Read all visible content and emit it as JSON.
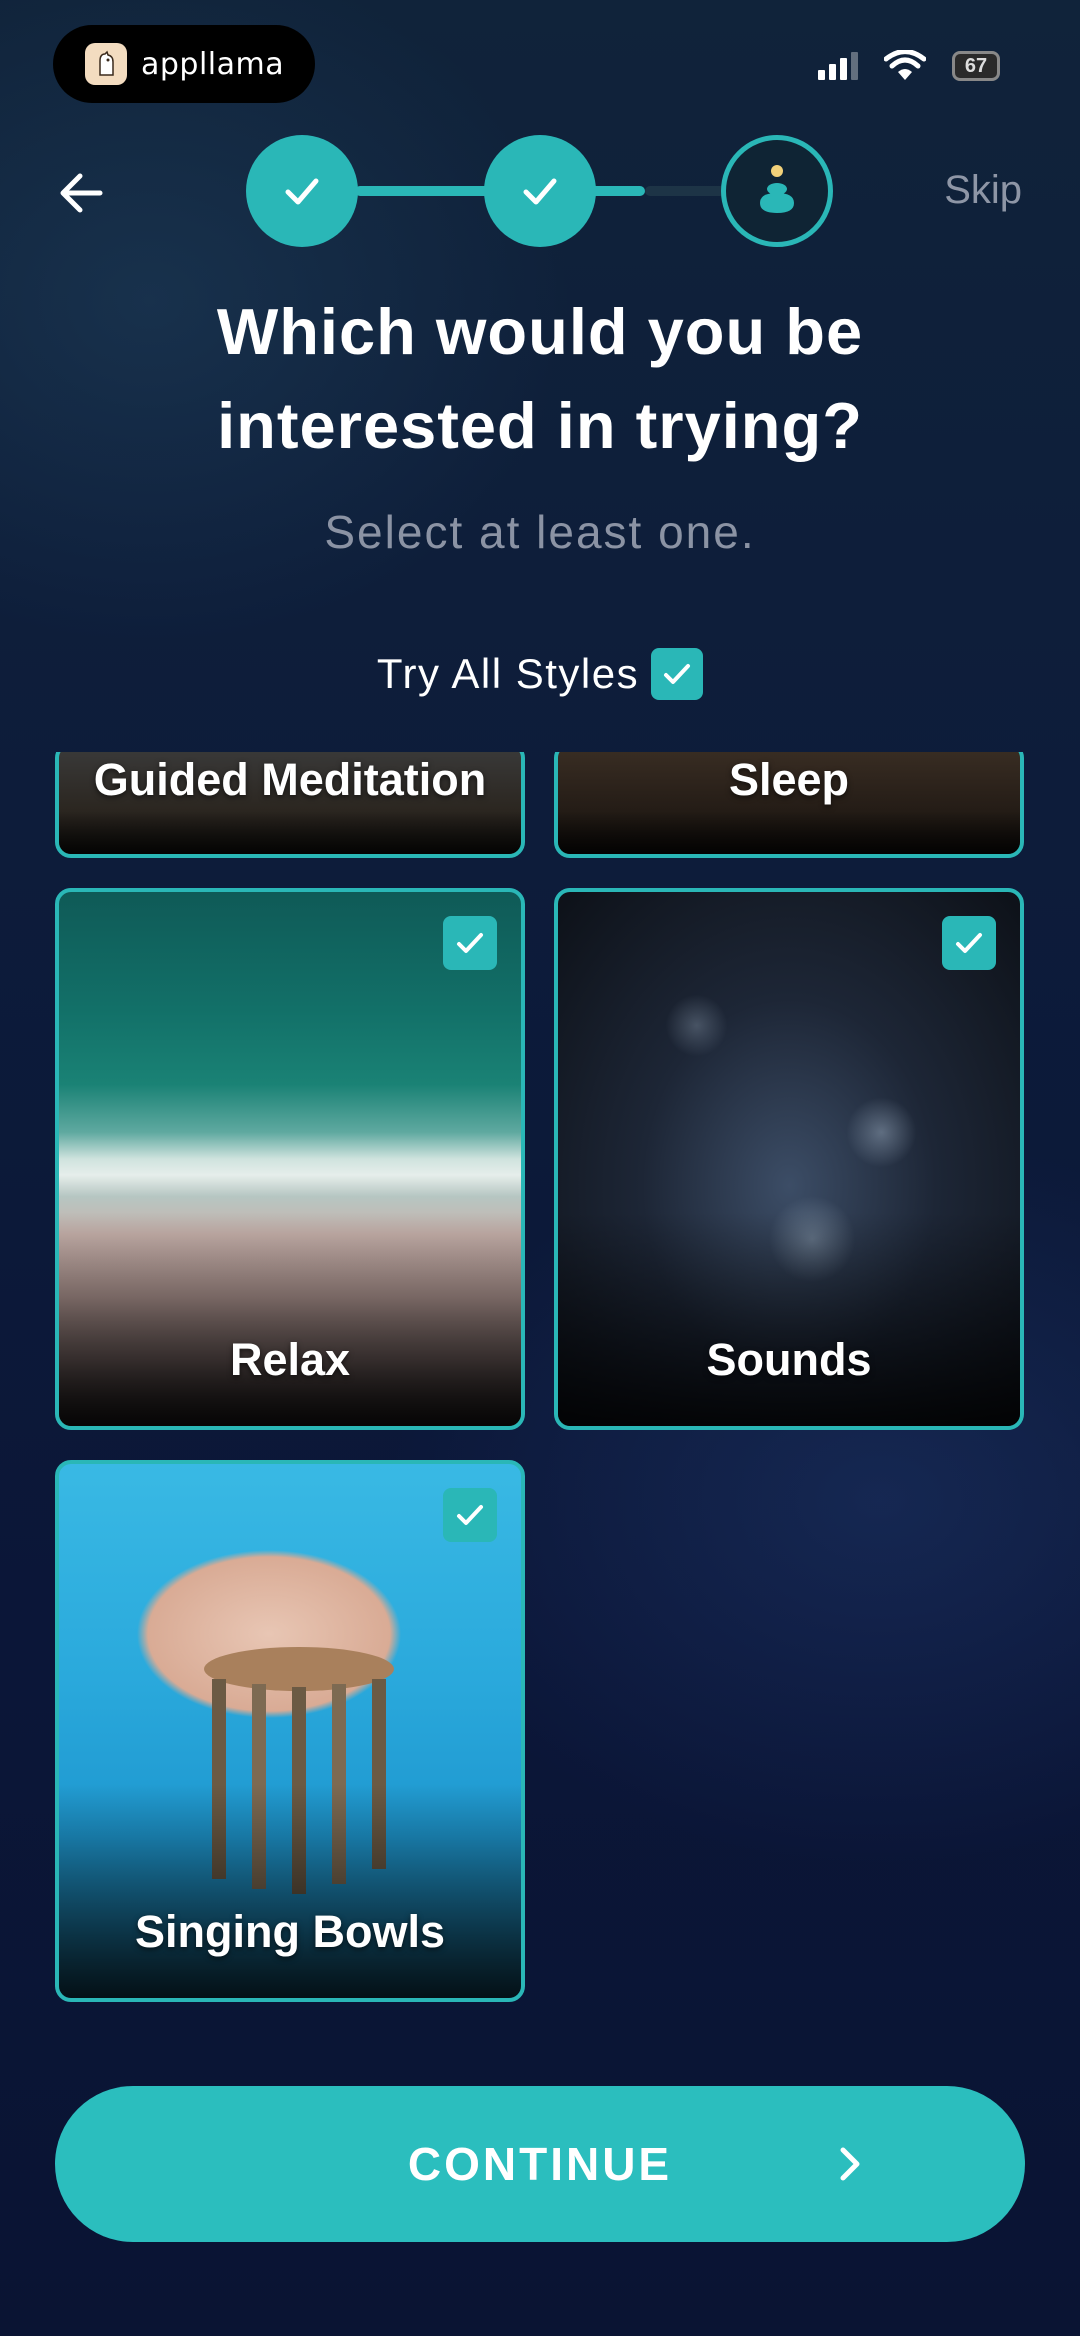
{
  "status_bar": {
    "brand_name": "appllama",
    "battery_label": "67"
  },
  "header": {
    "back_icon": "arrow-left-icon",
    "steps": [
      {
        "state": "done",
        "icon": "check-icon"
      },
      {
        "state": "done",
        "icon": "check-icon"
      },
      {
        "state": "current",
        "icon": "stacked-stones-icon"
      }
    ],
    "skip_label": "Skip"
  },
  "main": {
    "title": "Which would you be interested in trying?",
    "subtitle": "Select at least one.",
    "try_all_label": "Try All Styles",
    "try_all_checked": true
  },
  "styles": [
    {
      "label": "Guided Meditation",
      "checked": true
    },
    {
      "label": "Sleep",
      "checked": true
    },
    {
      "label": "Relax",
      "checked": true
    },
    {
      "label": "Sounds",
      "checked": true
    },
    {
      "label": "Singing Bowls",
      "checked": true
    }
  ],
  "footer": {
    "continue_label": "CONTINUE",
    "continue_icon": "chevron-right-icon"
  },
  "colors": {
    "accent": "#2ab7b7",
    "background": "#0d1c3a",
    "muted_text": "#8b93a4"
  }
}
